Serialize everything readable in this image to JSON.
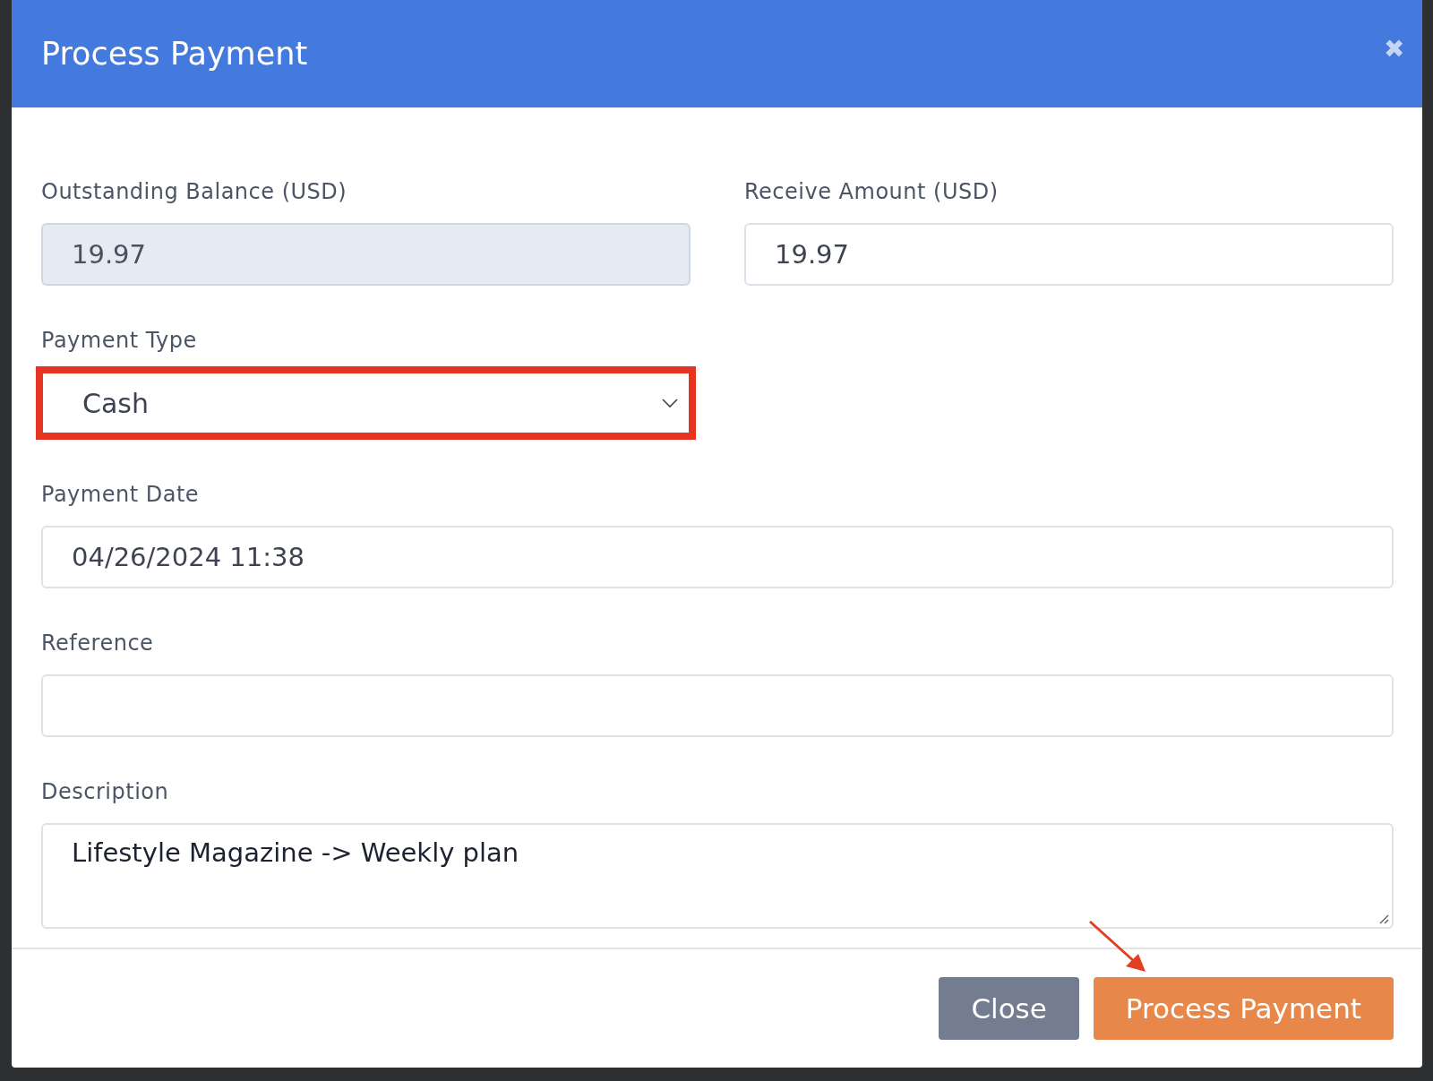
{
  "dialog": {
    "title": "Process Payment",
    "close_icon": "✖"
  },
  "rows": [
    {
      "fields": [
        {
          "kind": "input",
          "label": "Outstanding Balance (USD)",
          "value": "19.97",
          "disabled": true
        },
        {
          "kind": "input",
          "label": "Receive Amount (USD)",
          "value": "19.97",
          "disabled": false
        }
      ]
    },
    {
      "fields": [
        {
          "kind": "select",
          "label": "Payment Type",
          "value": "Cash",
          "highlighted": true
        }
      ]
    },
    {
      "fields": [
        {
          "kind": "input",
          "label": "Payment Date",
          "value": "04/26/2024 11:38",
          "disabled": false
        }
      ]
    },
    {
      "fields": [
        {
          "kind": "input",
          "label": "Reference",
          "disabled": false
        }
      ]
    },
    {
      "fields": [
        {
          "kind": "textarea",
          "label": "Description",
          "value": "Lifestyle Magazine -> Weekly plan"
        }
      ]
    }
  ],
  "buttons": [
    {
      "kind": "secondary",
      "label": "Close",
      "pointed": false
    },
    {
      "kind": "primary",
      "label": "Process Payment",
      "pointed": true
    }
  ]
}
